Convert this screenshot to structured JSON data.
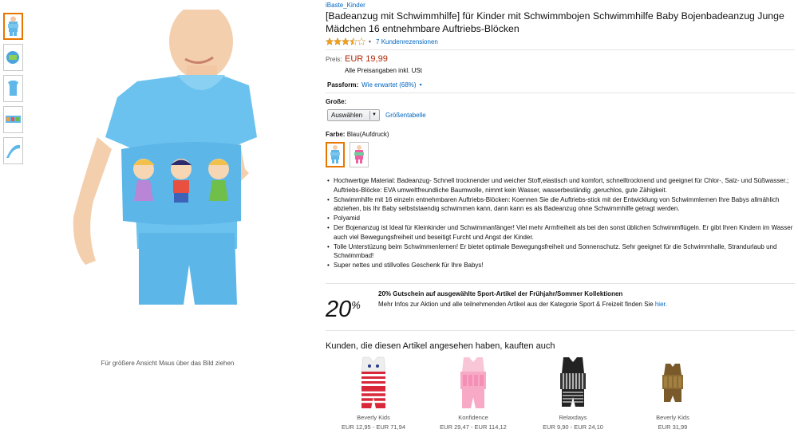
{
  "zoom_hint": "Für größere Ansicht Maus über das Bild ziehen",
  "product": {
    "brand": "iBaste_Kinder",
    "title": "[Badeanzug mit Schwimmhilfe] für Kinder mit Schwimmbojen Schwimmhilfe Baby Bojenbadeanzug Junge Mädchen 16 entnehmbare Auftriebs-Blöcken",
    "rating": 3.5,
    "reviews_link": "7 Kundenrezensionen"
  },
  "price": {
    "label": "Preis:",
    "value": "EUR 19,99",
    "note": "Alle Preisangaben inkl. USt"
  },
  "fit": {
    "label": "Passform:",
    "value": "Wie erwartet (68%)"
  },
  "size": {
    "label": "Große:",
    "select_value": "Auswählen",
    "chart_link": "Größentabelle"
  },
  "color": {
    "label": "Farbe:",
    "value": "Blau(Aufdruck)"
  },
  "bullets": [
    "Hochwertige Material: Badeanzug- Schnell trocknender und weicher Stoff,elastisch und komfort, schnelltrocknend und geeignet für Chlor-, Salz- und Süßwasser.; Auftriebs-Blöcke: EVA umweltfreundliche Baumwolle, nimmt kein Wasser, wasserbeständig ,geruchlos, gute Zähigkeit.",
    "Schwimmhilfe mit 16 einzeln entnehmbaren Auftriebs-Blöcken: Koennen Sie die Auftriebs-stick mit der Entwicklung von Schwimmlernen Ihre Babys allmählich abziehen, bis Ihr Baby selbststaendig schwimmen kann, dann kann es als Badeanzug ohne Schwimmhilfe getragt werden.",
    "Polyamid",
    "Der Bojenanzug ist Ideal für Kleinkinder und Schwimmanfänger! Viel mehr Armfreiheit als bei den sonst üblichen Schwimmflügeln. Er gibt Ihren Kindern im Wasser auch viel Bewegungsfreiheit und beseitigt Furcht und Angst der Kinder.",
    "Tolle Unterstüzung beim Schwimmenlernen! Er bietet optimale Bewegungsfreiheit und Sonnenschutz. Sehr geeignet für die Schwimmhalle, Strandurlaub und Schwimmbad!",
    "Super nettes und stillvolles Geschenk für Ihre Babys!"
  ],
  "promo": {
    "big_number": "20",
    "big_symbol": "%",
    "title": "20% Gutschein auf ausgewählte Sport-Artikel der Frühjahr/Sommer Kollektionen",
    "text": "Mehr Infos zur Aktion und alle teilnehmenden Artikel aus der Kategorie Sport & Freizeit finden Sie ",
    "link": "hier."
  },
  "also_viewed": {
    "title": "Kunden, die diesen Artikel angesehen haben, kauften auch",
    "items": [
      {
        "brand": "Beverly Kids",
        "price": "EUR 12,95 - EUR 71,94",
        "icon": "striped-swimsuit"
      },
      {
        "brand": "Konfidence",
        "price": "EUR 29,47 - EUR 114,12",
        "icon": "pink-swimsuit"
      },
      {
        "brand": "Relaxdays",
        "price": "EUR 9,90 - EUR 24,10",
        "icon": "black-swimsuit"
      },
      {
        "brand": "Beverly Kids",
        "price": "EUR 31,99",
        "icon": "brown-swimsuit"
      }
    ]
  },
  "colors": {
    "link": "#0066c0",
    "price": "#b12704",
    "selected_border": "#e77600",
    "star": "#f0a01d"
  }
}
